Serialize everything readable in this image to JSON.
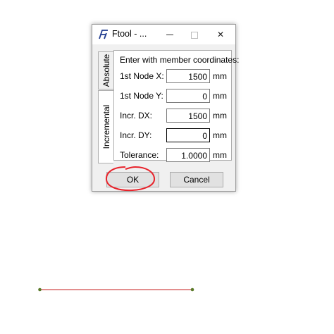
{
  "window": {
    "title": "Ftool - ...",
    "controls": {
      "minimize": "minimize-icon",
      "maximize": "maximize-icon",
      "close": "✕"
    }
  },
  "tabs": [
    {
      "label": "Absolute",
      "selected": false
    },
    {
      "label": "Incremental",
      "selected": true
    }
  ],
  "panel": {
    "header": "Enter with member coordinates:",
    "fields": [
      {
        "label": "1st Node X:",
        "value": "1500",
        "unit": "mm"
      },
      {
        "label": "1st Node Y:",
        "value": "0",
        "unit": "mm"
      },
      {
        "label": "Incr. DX:",
        "value": "1500",
        "unit": "mm"
      },
      {
        "label": "Incr. DY:",
        "value": "0",
        "unit": "mm"
      },
      {
        "label": "Tolerance:",
        "value": "1.0000",
        "unit": "mm"
      }
    ]
  },
  "buttons": {
    "ok": "OK",
    "cancel": "Cancel"
  },
  "colors": {
    "annotation_circle": "#e8232b",
    "member_line": "#d24b4b",
    "node_point": "#5a7a2a",
    "app_icon": "#1f3b8f"
  }
}
